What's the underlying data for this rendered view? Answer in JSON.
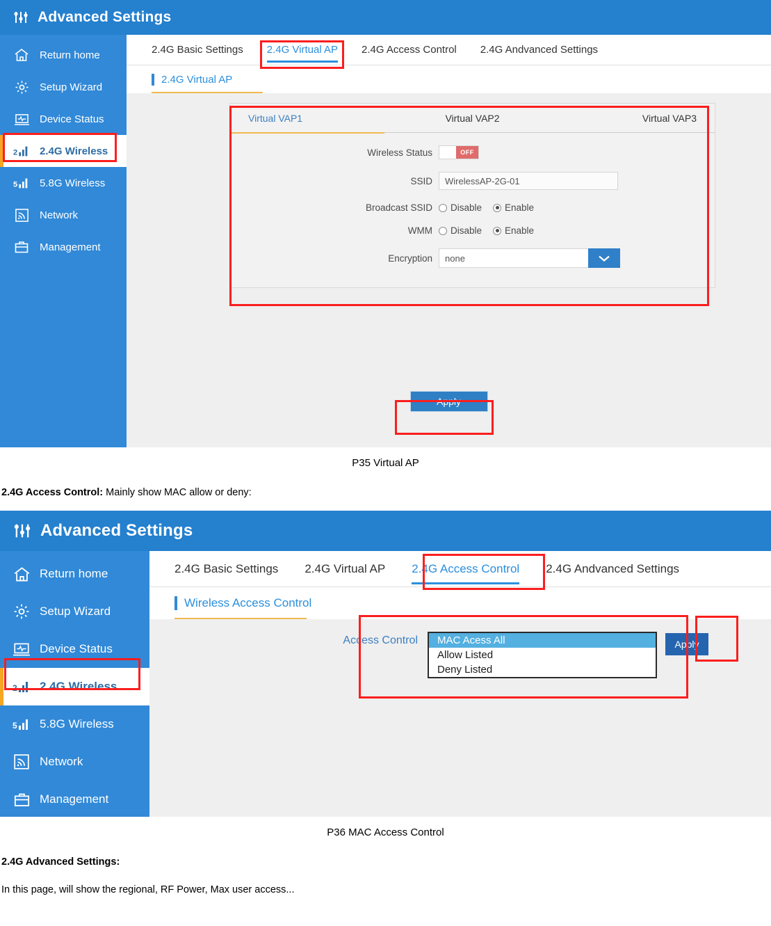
{
  "panel_virtual_ap": {
    "header": {
      "title": "Advanced Settings",
      "icon": "sliders-icon"
    },
    "sidebar": {
      "items": [
        {
          "label": "Return home",
          "icon": "home-icon",
          "active": false
        },
        {
          "label": "Setup Wizard",
          "icon": "gear-icon",
          "active": false
        },
        {
          "label": "Device Status",
          "icon": "monitor-icon",
          "active": false
        },
        {
          "label": "2.4G Wireless",
          "icon": "signal-2g-icon",
          "active": true
        },
        {
          "label": "5.8G Wireless",
          "icon": "signal-5g-icon",
          "active": false
        },
        {
          "label": "Network",
          "icon": "rss-icon",
          "active": false
        },
        {
          "label": "Management",
          "icon": "briefcase-icon",
          "active": false
        }
      ]
    },
    "tabs": [
      {
        "label": "2.4G Basic Settings",
        "active": false
      },
      {
        "label": "2.4G Virtual AP",
        "active": true
      },
      {
        "label": "2.4G Access Control",
        "active": false
      },
      {
        "label": "2.4G Andvanced Settings",
        "active": false
      }
    ],
    "section_title": "2.4G Virtual AP",
    "vap_tabs": [
      {
        "label": "Virtual VAP1",
        "active": true
      },
      {
        "label": "Virtual VAP2",
        "active": false
      },
      {
        "label": "Virtual VAP3",
        "active": false
      }
    ],
    "form": {
      "wireless_status": {
        "label": "Wireless Status",
        "state": "OFF"
      },
      "ssid": {
        "label": "SSID",
        "value": "WirelessAP-2G-01"
      },
      "broadcast_ssid": {
        "label": "Broadcast SSID",
        "disable": "Disable",
        "enable": "Enable",
        "selected": "Enable"
      },
      "wmm": {
        "label": "WMM",
        "disable": "Disable",
        "enable": "Enable",
        "selected": "Enable"
      },
      "encryption": {
        "label": "Encryption",
        "value": "none",
        "arrow": "chevron-down-icon"
      }
    },
    "apply_label": "Apply"
  },
  "caption_p35": "P35 Virtual AP",
  "doc_access_control": {
    "bold": "2.4G Access Control:",
    "rest": " Mainly show MAC allow or deny:"
  },
  "panel_access_control": {
    "header": {
      "title": "Advanced Settings",
      "icon": "sliders-icon"
    },
    "sidebar": {
      "items": [
        {
          "label": "Return home",
          "icon": "home-icon",
          "active": false
        },
        {
          "label": "Setup Wizard",
          "icon": "gear-icon",
          "active": false
        },
        {
          "label": "Device Status",
          "icon": "monitor-icon",
          "active": false
        },
        {
          "label": "2.4G Wireless",
          "icon": "signal-2g-icon",
          "active": true
        },
        {
          "label": "5.8G Wireless",
          "icon": "signal-5g-icon",
          "active": false
        },
        {
          "label": "Network",
          "icon": "rss-icon",
          "active": false
        },
        {
          "label": "Management",
          "icon": "briefcase-icon",
          "active": false
        }
      ]
    },
    "tabs": [
      {
        "label": "2.4G Basic Settings",
        "active": false
      },
      {
        "label": "2.4G Virtual AP",
        "active": false
      },
      {
        "label": "2.4G Access Control",
        "active": true
      },
      {
        "label": "2.4G Andvanced Settings",
        "active": false
      }
    ],
    "section_title": "Wireless Access Control",
    "access_control": {
      "label": "Access Control",
      "options": [
        {
          "label": "MAC Acess All",
          "selected": true
        },
        {
          "label": "Allow Listed",
          "selected": false
        },
        {
          "label": "Deny Listed",
          "selected": false
        }
      ]
    },
    "apply_label": "Apply"
  },
  "caption_p36": "P36 MAC Access Control",
  "doc_advanced": {
    "heading": "2.4G Advanced Settings:",
    "body": "In this page, will show the regional, RF Power, Max user access..."
  }
}
